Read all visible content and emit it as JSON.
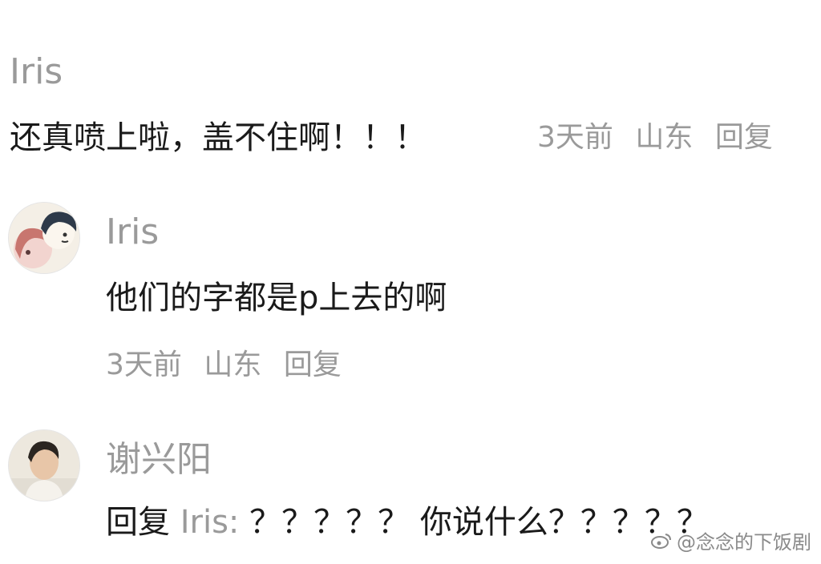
{
  "comments": [
    {
      "username": "Iris",
      "text": "还真喷上啦，盖不住啊！！！",
      "time": "3天前",
      "location": "山东",
      "reply_label": "回复"
    },
    {
      "username": "Iris",
      "text": "他们的字都是p上去的啊",
      "time": "3天前",
      "location": "山东",
      "reply_label": "回复",
      "avatar_icon": "cartoon-avatar-icon"
    },
    {
      "username": "谢兴阳",
      "reply_prefix": "回复",
      "mention": "Iris:",
      "text": "？？？？？ 你说什么？？？？？",
      "avatar_icon": "photo-avatar-icon"
    }
  ],
  "watermark": {
    "icon": "weibo-icon",
    "text": "@念念的下饭剧"
  }
}
